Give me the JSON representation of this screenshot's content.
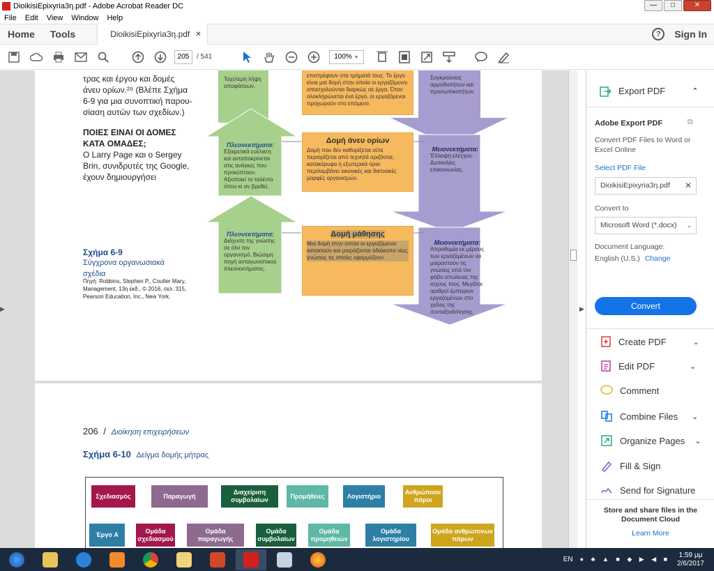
{
  "window": {
    "title": "DioikisiEpixyria3η.pdf - Adobe Acrobat Reader DC",
    "min": "—",
    "max": "□",
    "close": "✕"
  },
  "menu": [
    "File",
    "Edit",
    "View",
    "Window",
    "Help"
  ],
  "nav": {
    "home": "Home",
    "tools": "Tools",
    "doc_tab": "DioikisiEpixyria3η.pdf",
    "tab_close": "✕",
    "help": "?",
    "sign_in": "Sign In"
  },
  "toolbar": {
    "page_current": "205",
    "page_total": "/ 541",
    "zoom": "100%"
  },
  "page1": {
    "top_text": [
      "τρας και έργου και δομές",
      "άνευ ορίων.²⁹ (Βλέπε Σχήμα",
      "6-9 για μια συνοπτική παρου-",
      "σίαση αυτών των σχεδίων.)"
    ],
    "section_heading": "ΠΟΙΕΣ ΕΙΝΑΙ ΟΙ ΔΟΜΕΣ ΚΑΤΑ ΟΜΑΔΕΣ;",
    "section_text": "Ο Larry Page και ο Sergey Brin, συνιδρυτές της Google, έχουν δημιουργήσει",
    "figure_label": "Σχήμα 6-9",
    "figure_title": "Σύγχρονα οργανωσιακά σχέδια",
    "source": "Πηγή: Robbins, Stephen P., Coulter Mary, Management, 13η έκδ., © 2016, σελ. 315, Pearson Education, Inc., New York.",
    "green_top": "Ταχύτερη λήψη αποφάσεων.",
    "orange_top": "επιστρέφουν στα τμήματά τους. Το έργο είναι μια δομή στην οποία οι εργαζόμενοι απασχολούνται διαρκώς σε έργα. Όταν ολοκληρώνεται ένα έργο, οι εργαζόμενοι προχωρούν στο επόμενο.",
    "purple_top": "Συγκρούσεις αρμοδιοτήτων και προσωπικοτήτων.",
    "adv1_title": "Πλεονεκτήματα:",
    "adv1_text": "Εξαιρετικά ευέλικτη και ανταποκρίνεται στις ανάγκες που προκύπτουν. Αξιοποιεί το ταλέντο όπου κι αν βρεθεί.",
    "bl_title": "Δομή άνευ ορίων",
    "bl_text": "Δομή που δεν καθορίζεται ούτε περιορίζεται από τεχνητά οριζόντια, κατακόρυφα ή εξωτερικά όρια· περιλαμβάνει εικονικές και δικτυακές μορφές οργανισμών.",
    "dis1_title": "Μειονεκτήματα:",
    "dis1_text": "Έλλειψη ελέγχου. Δυσκολίες επικοινωνίας.",
    "adv2_title": "Πλεονεκτήματα:",
    "adv2_text": "Διάχυση της γνώσης σε όλο τον οργανισμό. Βιώσιμη πηγή ανταγωνιστικού πλεονεκτήματος.",
    "lo_title": "Δομή μάθησης",
    "lo_text": "Μια δομή στην οποία οι εργαζόμενοι κατακτούν και μοιράζονται αδιάκοπα νέες γνώσεις τις οποίες εφαρμόζουν.",
    "dis2_title": "Μειονεκτήματα:",
    "dis2_text": "Απροθυμία εκ μέρους των εργαζομένων να μοιραστούν τις γνώσεις υπό τον φόβο απώλειας της ισχύος τους. Μεγάλοι αριθμοί έμπειρων εργαζομένων στο χείλος της συνταξιοδότησης."
  },
  "page2": {
    "page_number": "206",
    "running_head": "Διοίκηση επιχειρήσεων",
    "figure_label": "Σχήμα 6-10",
    "figure_title": "Δείγμα δομής μήτρας",
    "top_boxes": [
      "Σχεδιασμός",
      "Παραγωγή",
      "Διαχείριση συμβολαίων",
      "Προμήθειες",
      "Λογιστήριο",
      "Ανθρώπινοι πόροι"
    ],
    "bottom_boxes": [
      "Έργο A",
      "Ομάδα σχεδιασμού",
      "Ομάδα παραγωγής",
      "Ομάδα συμβολαίων",
      "Ομάδα προμηθειών",
      "Ομάδα λογιστηρίου",
      "Ομάδα ανθρώπινων πόρων"
    ]
  },
  "panel": {
    "export_title": "Export PDF",
    "adobe_export": "Adobe Export PDF",
    "desc": "Convert PDF Files to Word or Excel Online",
    "select_file": "Select PDF File",
    "file_name": "DioikisiEpixyria3η.pdf",
    "convert_to": "Convert to",
    "format": "Microsoft Word (*.docx)",
    "lang_label": "Document Language:",
    "lang_value": "English (U.S.)",
    "lang_change": "Change",
    "convert_btn": "Convert",
    "tools": [
      "Create PDF",
      "Edit PDF",
      "Comment",
      "Combine Files",
      "Organize Pages",
      "Fill & Sign",
      "Send for Signature"
    ],
    "store_text": "Store and share files in the Document Cloud",
    "learn_more": "Learn More"
  },
  "taskbar": {
    "lang": "EN",
    "time": "1:59 μμ",
    "date": "2/6/2017"
  }
}
